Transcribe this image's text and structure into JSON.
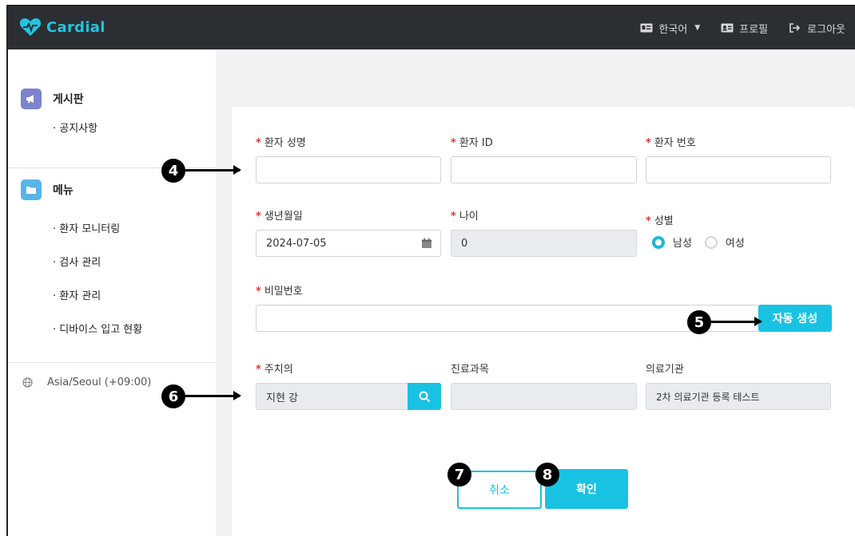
{
  "app": {
    "logo_text": "Cardial"
  },
  "topbar": {
    "language": "한국어",
    "profile": "프로필",
    "logout": "로그아웃"
  },
  "sidebar": {
    "board": {
      "label": "게시판",
      "items": [
        "공지사항"
      ]
    },
    "menu": {
      "label": "메뉴",
      "items": [
        "환자 모니터링",
        "검사 관리",
        "환자 관리",
        "디바이스 입고 현황"
      ]
    },
    "timezone": "Asia/Seoul (+09:00)"
  },
  "form": {
    "patient_name": {
      "label": "환자 성명",
      "value": ""
    },
    "patient_id": {
      "label": "환자 ID",
      "value": ""
    },
    "patient_number": {
      "label": "환자 번호",
      "value": ""
    },
    "birthdate": {
      "label": "생년월일",
      "value": "2024-07-05"
    },
    "age": {
      "label": "나이",
      "value": "0"
    },
    "gender": {
      "label": "성별",
      "options": [
        "남성",
        "여성"
      ],
      "selected": "남성"
    },
    "password": {
      "label": "비밀번호",
      "value": "",
      "generate_label": "자동 생성"
    },
    "attending_doctor": {
      "label": "주치의",
      "value": "지현 강"
    },
    "department": {
      "label": "진료과목",
      "value": ""
    },
    "institution": {
      "label": "의료기관",
      "value": "2차 의료기관 등록 테스트"
    },
    "cancel_label": "취소",
    "confirm_label": "확인"
  },
  "markers": [
    "4",
    "5",
    "6",
    "7",
    "8"
  ],
  "colors": {
    "accent": "#19c2e3",
    "topbar": "#2b2f33",
    "required": "#e3342f"
  }
}
